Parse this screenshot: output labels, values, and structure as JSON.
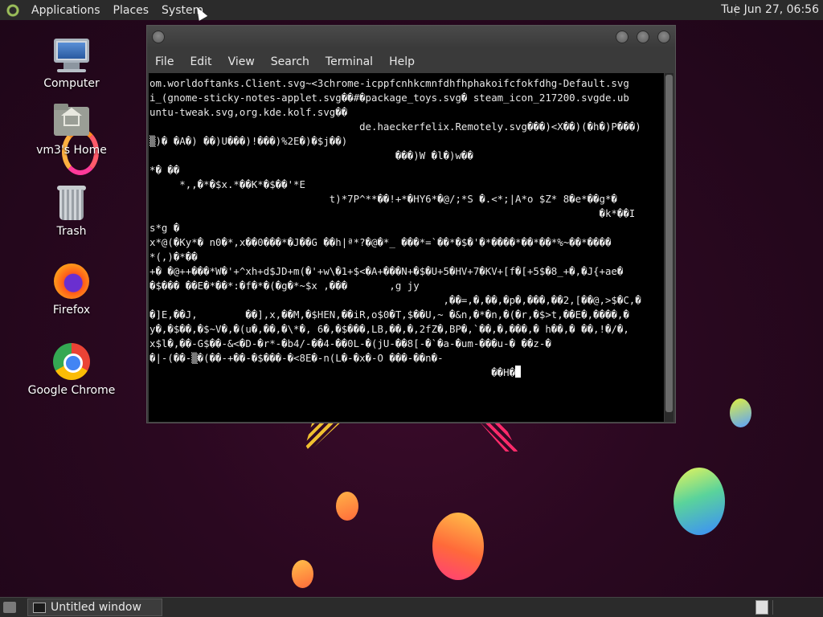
{
  "top_panel": {
    "menus": [
      "Applications",
      "Places",
      "System"
    ],
    "clock": "Tue Jun 27, 06:56"
  },
  "desktop_icons": [
    {
      "label": "Computer",
      "icon": "computer-icon"
    },
    {
      "label": "vm3's Home",
      "icon": "home-folder-icon"
    },
    {
      "label": "Trash",
      "icon": "trash-icon"
    },
    {
      "label": "Firefox",
      "icon": "firefox-icon"
    },
    {
      "label": "Google Chrome",
      "icon": "chrome-icon"
    }
  ],
  "terminal": {
    "menu": [
      "File",
      "Edit",
      "View",
      "Search",
      "Terminal",
      "Help"
    ],
    "lines": [
      "om.worldoftanks.Client.svg~<3chrome-icppfcnhkcmnfdhfhphakoifcfokfdhg-Default.svg",
      "i_(gnome-sticky-notes-applet.svg��#�package_toys.svg� steam_icon_217200.svgde.ub",
      "untu-tweak.svg,org.kde.kolf.svg��",
      "                                   de.haeckerfelix.Remotely.svg���)<X��)(�h�)P���)",
      "▒)� �A�) ��)U���)!���)%2E�)�$j��)",
      "                                         ���)W �l�)w��",
      "*� ��",
      "     *,,�*�$x.*��K*�$��'*E",
      "                              t)*7P^**��!+*�HY6*�@/;*S �.<*;|A*o $Z* 8�e*��g*�",
      "                                                                           �k*��I",
      "s*g �",
      "x*@(�Ky*� n0�*,x��0���*�J��G ��h|ª*?�@�*_ ���*=`��*�$�'�*����*��*��*%~��*����",
      "*(,)�*��",
      "+� �@++���*W�'+^xh+d$JD+m(�'+w\\�1+$<�A+���N+�$�U+5�HV+7�KV+[f�[+5$�8_+�,�J{+ae�",
      "�$��� ��E�*��*:�f�*�(�g�*~$x ,���       ,g jy",
      "                                                 ,��=,�,��,�p�,���,��2,[��@,>$�C,�",
      "�]E,��J,        ��],x,��M,�$HEN,��iR,o$0�T,$��U,~ �&n,�*�n,�(�r,�$>t,��E�,����,�",
      "y�,�$��,�$~V�,�(u�,��,�\\*�, 6�,�$���,LB,��,�,2fZ�,BP�,`��,�,���,� h��,� ��,!�/�,",
      "x$l�,��-G$��-&<�D-�r*-�b4/-��4-��0L-�(jU-��8[-�`�a-�um-���u-� ��z-�",
      "�|-(��-▒�(��-+��-�$���-�<8E�-n(L�-�x�-O ���-��n�-",
      "                                                         ��H�"
    ]
  },
  "taskbar": {
    "task_label": "Untitled window"
  }
}
